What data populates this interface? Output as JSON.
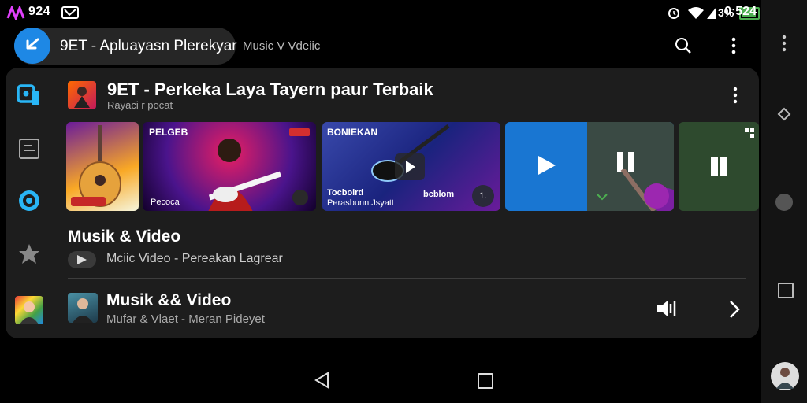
{
  "status": {
    "time_left": "924",
    "time_right": "0:524",
    "battery_text": "3%"
  },
  "appbar": {
    "title": "9ET - Apluayasn Plerekyar",
    "subtitle": "Music V Vdeiic"
  },
  "header": {
    "title": "9ET - Perkeka Laya Tayern paur Terbaik",
    "subtitle": "Rayaci r pocat"
  },
  "tiles": [
    {
      "label": "",
      "caption": ""
    },
    {
      "label": "PELGEB",
      "caption": "Pecoca"
    },
    {
      "label": "BONIEKAN",
      "caption": "Tocbolrd",
      "caption2": "Perasbunn.Jsyatt",
      "badge": "bcblom",
      "counter": "1."
    },
    {
      "label": "",
      "caption": ""
    },
    {
      "label": "",
      "caption": ""
    }
  ],
  "section": {
    "title": "Musik & Video",
    "subtitle": "Mciic Video - Pereakan Lagrear"
  },
  "row": {
    "title": "Musik && Video",
    "subtitle": "Mufar & Vlaet - Meran Pideyet"
  },
  "colors": {
    "accent": "#1e88e5",
    "battery": "#4caf50",
    "purple": "#9c27b0"
  }
}
